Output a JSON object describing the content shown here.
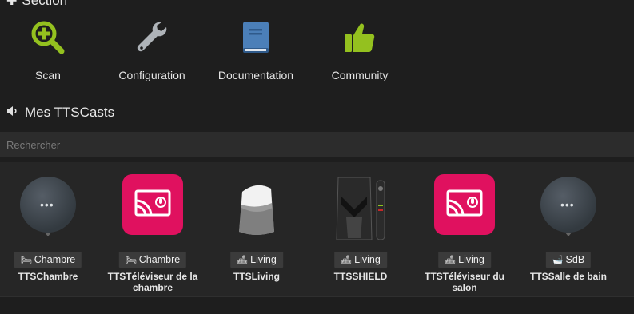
{
  "section": {
    "title": "Section"
  },
  "actions": [
    {
      "label": "Scan",
      "icon": "search-plus-icon"
    },
    {
      "label": "Configuration",
      "icon": "wrench-icon"
    },
    {
      "label": "Documentation",
      "icon": "book-icon"
    },
    {
      "label": "Community",
      "icon": "thumbs-up-icon"
    }
  ],
  "casts": {
    "title": "Mes TTSCasts",
    "search_placeholder": "Rechercher",
    "items": [
      {
        "room": "Chambre",
        "room_icon": "bed-icon",
        "name": "TTSChambre",
        "device": "speaker-mini"
      },
      {
        "room": "Chambre",
        "room_icon": "bed-icon",
        "name": "TTSTéléviseur de la chambre",
        "device": "cast-tv"
      },
      {
        "room": "Living",
        "room_icon": "sofa-icon",
        "name": "TTSLiving",
        "device": "home-speaker"
      },
      {
        "room": "Living",
        "room_icon": "sofa-icon",
        "name": "TTSSHIELD",
        "device": "shield"
      },
      {
        "room": "Living",
        "room_icon": "sofa-icon",
        "name": "TTSTéléviseur du salon",
        "device": "cast-tv"
      },
      {
        "room": "SdB",
        "room_icon": "bath-icon",
        "name": "TTSSalle de bain",
        "device": "speaker-mini"
      }
    ]
  },
  "colors": {
    "accent_green": "#94c11f",
    "book_blue": "#4b7fb8",
    "cast_red": "#e0115f"
  }
}
